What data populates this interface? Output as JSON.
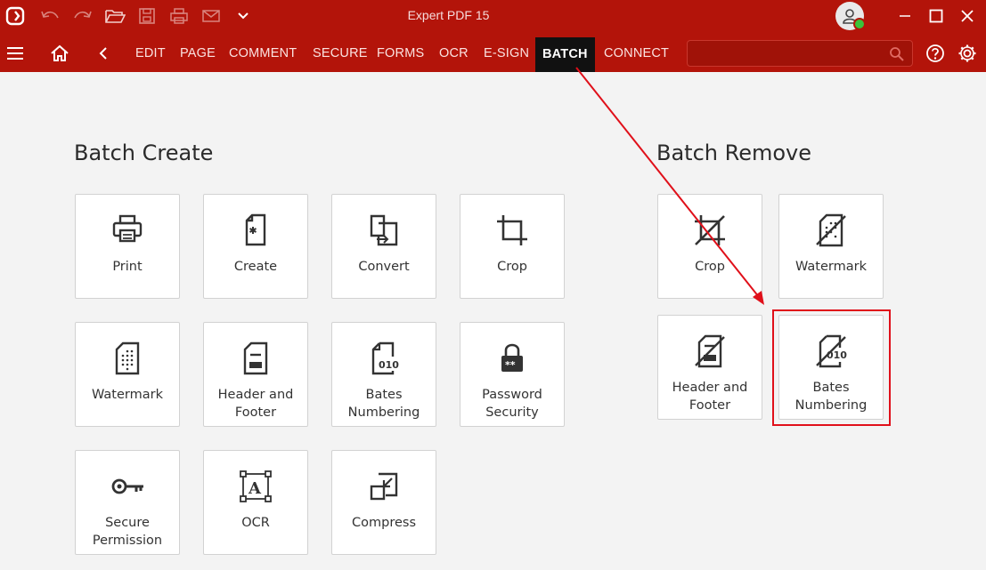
{
  "window": {
    "title": "Expert PDF 15",
    "accent_color": "#b3140a"
  },
  "toolbar": {
    "icons": [
      "app-logo-icon",
      "undo-icon",
      "redo-icon",
      "open-folder-icon",
      "save-icon",
      "print-icon",
      "email-icon",
      "chevron-down-icon"
    ]
  },
  "menu": {
    "items": [
      "EDIT",
      "PAGE",
      "COMMENT",
      "SECURE",
      "FORMS",
      "OCR",
      "E-SIGN",
      "BATCH",
      "CONNECT"
    ],
    "active": "BATCH",
    "search_placeholder": ""
  },
  "batch_create": {
    "title": "Batch Create",
    "tiles": [
      {
        "label": "Print",
        "icon": "print-icon"
      },
      {
        "label": "Create",
        "icon": "create-document-icon"
      },
      {
        "label": "Convert",
        "icon": "convert-icon"
      },
      {
        "label": "Crop",
        "icon": "crop-icon"
      },
      {
        "label_lines": [
          "Watermark"
        ],
        "icon": "watermark-icon"
      },
      {
        "label_lines": [
          "Header and",
          "Footer"
        ],
        "icon": "header-footer-icon"
      },
      {
        "label_lines": [
          "Bates",
          "Numbering"
        ],
        "icon": "bates-numbering-icon"
      },
      {
        "label_lines": [
          "Password",
          "Security"
        ],
        "icon": "password-lock-icon"
      },
      {
        "label_lines": [
          "Secure",
          "Permission"
        ],
        "icon": "key-icon"
      },
      {
        "label_lines": [
          "OCR"
        ],
        "icon": "ocr-icon"
      },
      {
        "label_lines": [
          "Compress"
        ],
        "icon": "compress-icon"
      }
    ]
  },
  "batch_remove": {
    "title": "Batch Remove",
    "tiles": [
      {
        "label": "Crop",
        "icon": "remove-crop-icon"
      },
      {
        "label": "Watermark",
        "icon": "remove-watermark-icon"
      },
      {
        "label_lines": [
          "Header and",
          "Footer"
        ],
        "icon": "remove-header-footer-icon"
      },
      {
        "label_lines": [
          "Bates",
          "Numbering"
        ],
        "icon": "remove-bates-numbering-icon"
      }
    ]
  },
  "annotation": {
    "color": "#e0101a",
    "highlighted": "Bates Numbering"
  }
}
